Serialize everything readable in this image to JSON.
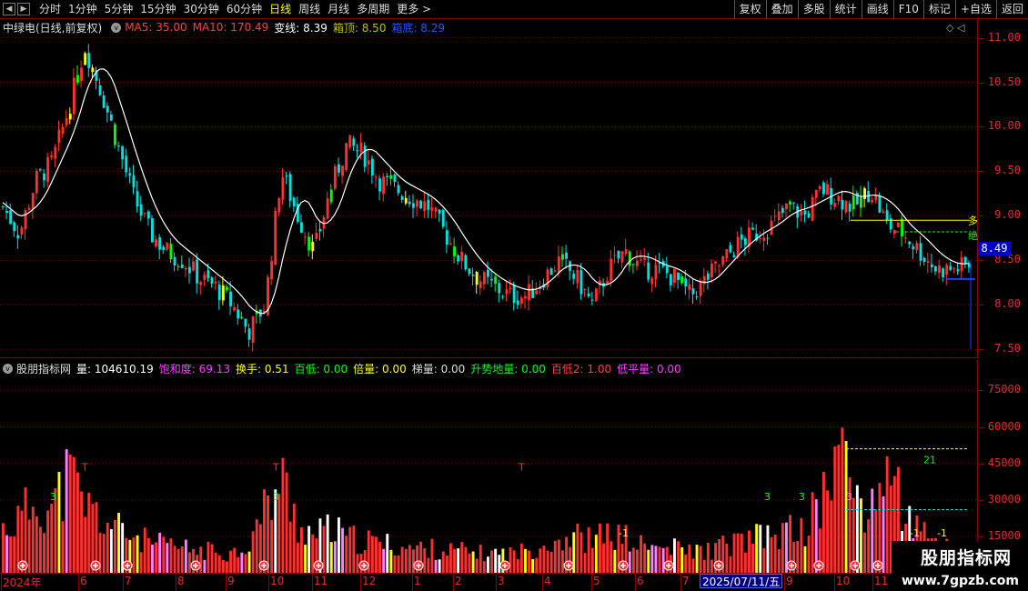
{
  "toolbar": {
    "periods": [
      "分时",
      "1分钟",
      "5分钟",
      "15分钟",
      "30分钟",
      "60分钟",
      "日线",
      "周线",
      "月线",
      "多周期"
    ],
    "active_period": "日线",
    "more_label": "更多",
    "more_arrow": ">",
    "nav_prev": "◀",
    "nav_next": "▶",
    "tools": [
      "复权",
      "叠加",
      "多股",
      "统计",
      "画线",
      "F10",
      "标记",
      "+自选",
      "返回"
    ]
  },
  "price_header": {
    "stock_name": "中绿电(日线,前复权)",
    "ma5": "MA5: 35.00",
    "ma10": "MA10: 170.49",
    "bianxian": "变线: 8.39",
    "xiangding": "箱顶: 8.50",
    "xiangdi": "箱底: 8.29"
  },
  "volume_header": {
    "indicator_name": "股朋指标网",
    "volume": "量: 104610.19",
    "saturation": "饱和度: 69.13",
    "turnover": "换手: 0.51",
    "bai_di": "百低: 0.00",
    "bei_liang": "倍量: 0.00",
    "ti_liang": "梯量: 0.00",
    "sheng_shi": "升势地量: 0.00",
    "bai_di2": "百低2: 1.00",
    "di_ping": "低平量: 0.00"
  },
  "price_axis": [
    "11.00",
    "10.50",
    "10.00",
    "9.50",
    "9.00",
    "8.50",
    "8.00",
    "7.50"
  ],
  "volume_axis": [
    "75000",
    "60000",
    "45000",
    "30000",
    "15000"
  ],
  "current_price": "8.49",
  "dates": [
    "2024年",
    "6",
    "7",
    "8",
    "9",
    "10",
    "11",
    "12",
    "1",
    "2",
    "3",
    "4",
    "5",
    "6",
    "7",
    "9",
    "10",
    "11"
  ],
  "date_highlight": "2025/07/11/五",
  "chart_annotations": {
    "volume_label_21": "21",
    "marker_T": "T",
    "marker_3": "3",
    "marker_neg1": "-1",
    "side_text_1": "多",
    "side_text_2": "绝"
  },
  "corner_icons": "◇ ◁",
  "watermark": {
    "title": "股朋指标网",
    "url": "www.7gpzb.com"
  },
  "colors": {
    "up": "#ff3030",
    "down": "#00e0e0",
    "ma_white": "#ffffff",
    "ma_cyan": "#40d0ff",
    "box_top": "#ffff00",
    "box_mid": "#00ff00",
    "box_bottom": "#2040ff",
    "green_bar": "#00ff00",
    "yellow_bar": "#ffff00"
  },
  "chart_data": {
    "type": "candlestick",
    "ylim": [
      7.4,
      11.2
    ],
    "volume_ylim": [
      0,
      80000
    ],
    "x": [
      "2024年",
      "6",
      "7",
      "8",
      "9",
      "10",
      "11",
      "12",
      "1",
      "2",
      "3",
      "4",
      "5",
      "6",
      "7",
      "9",
      "10",
      "11"
    ],
    "close": [
      9.1,
      8.8,
      9.4,
      9.6,
      10.2,
      10.9,
      10.4,
      9.8,
      9.2,
      8.8,
      8.6,
      8.5,
      8.3,
      8.2,
      8.0,
      7.7,
      8.0,
      9.5,
      9.0,
      8.6,
      9.3,
      9.8,
      9.7,
      9.4,
      9.3,
      9.2,
      9.1,
      8.8,
      8.5,
      8.3,
      8.2,
      8.1,
      8.1,
      8.3,
      8.5,
      8.3,
      8.0,
      8.4,
      8.6,
      8.4,
      8.4,
      8.3,
      8.1,
      8.3,
      8.5,
      8.7,
      8.8,
      8.9,
      9.1,
      9.0,
      9.3,
      9.2,
      9.1,
      9.3,
      8.9,
      8.8,
      8.6,
      8.4,
      8.4,
      8.45
    ],
    "volume": [
      18000,
      22000,
      30000,
      26000,
      40000,
      28000,
      22000,
      18000,
      15000,
      12000,
      11000,
      10000,
      9000,
      9000,
      8000,
      12000,
      26000,
      38000,
      20000,
      15000,
      18000,
      14000,
      13000,
      12000,
      11000,
      10000,
      10000,
      9000,
      9000,
      8000,
      8000,
      8000,
      9000,
      12000,
      14000,
      15000,
      13000,
      16000,
      14000,
      11000,
      10000,
      10000,
      9000,
      9000,
      11000,
      13000,
      14000,
      15000,
      17000,
      18000,
      30000,
      50000,
      35000,
      22000,
      48000,
      25000,
      16000,
      12000,
      11000,
      10000
    ]
  }
}
